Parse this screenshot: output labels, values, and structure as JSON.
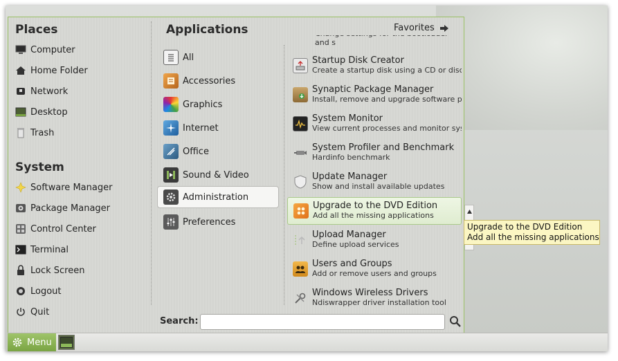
{
  "places": {
    "heading": "Places",
    "items": [
      {
        "label": "Computer",
        "icon": "computer-icon"
      },
      {
        "label": "Home Folder",
        "icon": "home-icon"
      },
      {
        "label": "Network",
        "icon": "network-icon"
      },
      {
        "label": "Desktop",
        "icon": "desktop-icon"
      },
      {
        "label": "Trash",
        "icon": "trash-icon"
      }
    ]
  },
  "system": {
    "heading": "System",
    "items": [
      {
        "label": "Software Manager",
        "icon": "software-manager-icon"
      },
      {
        "label": "Package Manager",
        "icon": "package-manager-icon"
      },
      {
        "label": "Control Center",
        "icon": "control-center-icon"
      },
      {
        "label": "Terminal",
        "icon": "terminal-icon"
      },
      {
        "label": "Lock Screen",
        "icon": "lock-icon"
      },
      {
        "label": "Logout",
        "icon": "logout-icon"
      },
      {
        "label": "Quit",
        "icon": "power-icon"
      }
    ]
  },
  "applications": {
    "heading": "Applications",
    "favorites_label": "Favorites",
    "categories": [
      {
        "label": "All",
        "icon": "all-icon"
      },
      {
        "label": "Accessories",
        "icon": "accessories-icon"
      },
      {
        "label": "Graphics",
        "icon": "graphics-icon"
      },
      {
        "label": "Internet",
        "icon": "internet-icon"
      },
      {
        "label": "Office",
        "icon": "office-icon"
      },
      {
        "label": "Sound & Video",
        "icon": "sound-video-icon"
      },
      {
        "label": "Administration",
        "icon": "administration-icon"
      },
      {
        "label": "Preferences",
        "icon": "preferences-icon"
      }
    ],
    "selected_category": "Administration",
    "cut_off_desc": "Change settings for the bootloader and s",
    "apps": [
      {
        "name": "Startup Disk Creator",
        "desc": "Create a startup disk using a CD or disc i",
        "icon": "startup-disk-icon"
      },
      {
        "name": "Synaptic Package Manager",
        "desc": "Install, remove and upgrade software pa",
        "icon": "synaptic-icon"
      },
      {
        "name": "System Monitor",
        "desc": "View current processes and monitor syst",
        "icon": "system-monitor-icon"
      },
      {
        "name": "System Profiler and Benchmark",
        "desc": "Hardinfo benchmark",
        "icon": "profiler-icon"
      },
      {
        "name": "Update Manager",
        "desc": "Show and install available updates",
        "icon": "update-shield-icon"
      },
      {
        "name": "Upgrade to the DVD Edition",
        "desc": "Add all the missing applications",
        "icon": "dvd-upgrade-icon"
      },
      {
        "name": "Upload Manager",
        "desc": "Define upload services",
        "icon": "upload-icon"
      },
      {
        "name": "Users and Groups",
        "desc": "Add or remove users and groups",
        "icon": "users-icon"
      },
      {
        "name": "Windows Wireless Drivers",
        "desc": "Ndiswrapper driver installation tool",
        "icon": "wireless-drivers-icon"
      }
    ]
  },
  "search": {
    "label": "Search:",
    "value": "",
    "placeholder": ""
  },
  "tooltip": {
    "line1": "Upgrade to the DVD Edition",
    "line2": "Add all the missing applications"
  },
  "panel": {
    "menu_label": "Menu"
  },
  "colors": {
    "accent": "#8db85a",
    "tooltip_bg": "#fbf6c3"
  }
}
